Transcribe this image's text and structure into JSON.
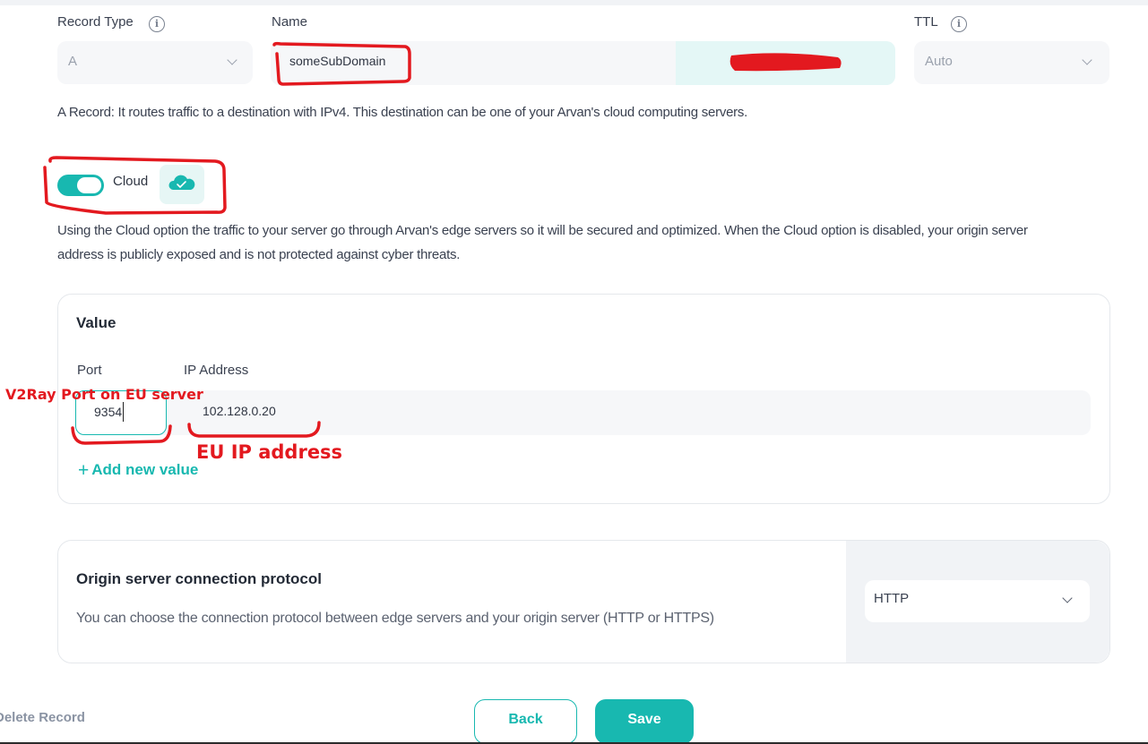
{
  "record_type": {
    "label": "Record Type",
    "value": "A",
    "info_icon": "info-icon"
  },
  "name": {
    "label": "Name",
    "value": "someSubDomain"
  },
  "ttl": {
    "label": "TTL",
    "value": "Auto",
    "info_icon": "info-icon"
  },
  "record_description": "A Record: It routes traffic to a destination with IPv4. This destination can be one of your Arvan's cloud computing servers.",
  "cloud": {
    "label": "Cloud",
    "enabled": true,
    "icon": "cloud-check-icon",
    "description_line1": "Using the Cloud option the traffic to your server go through Arvan's edge servers so it will be secured and optimized. When the Cloud option is disabled, your origin server",
    "description_line2": "address is publicly exposed and is not protected against cyber threats."
  },
  "value_card": {
    "title": "Value",
    "port_label": "Port",
    "ip_label": "IP Address",
    "port_value": "9354",
    "ip_value": "102.128.0.20",
    "add_link": "Add new value"
  },
  "protocol_card": {
    "title": "Origin server connection protocol",
    "description": "You can choose the connection protocol between edge servers and your origin server (HTTP or HTTPS)",
    "selected": "HTTP"
  },
  "footer": {
    "delete_label": "Delete Record",
    "back_label": "Back",
    "save_label": "Save"
  },
  "annotations": {
    "port_note": "V2Ray Port on EU server",
    "ip_note": "EU IP address",
    "color": "#e3191f"
  },
  "colors": {
    "accent": "#18b8b0",
    "field_bg": "#f6f7f9"
  }
}
